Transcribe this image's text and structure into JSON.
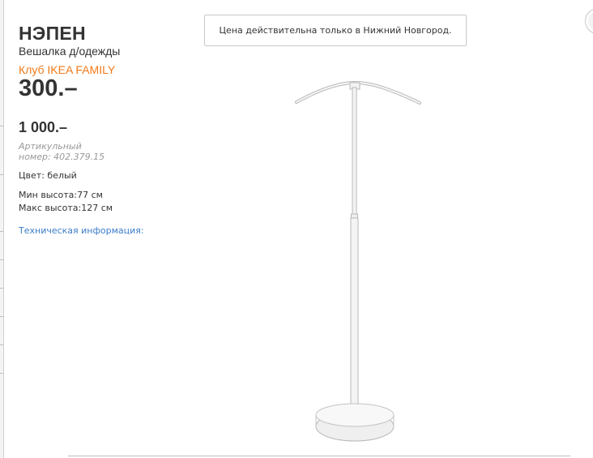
{
  "product": {
    "name": "НЭПЕН",
    "type": "Вешалка д/одежды",
    "family_label": "Клуб IKEA FAMILY",
    "family_price": "300.–",
    "regular_price": "1 000.–",
    "article_label": "Артикульный",
    "article_number": "номер: 402.379.15",
    "color": "Цвет: белый",
    "min_height": "Мин высота:77 см",
    "max_height": "Макс высота:127 см",
    "tech_info_link": "Техническая информация:"
  },
  "notice": {
    "text": "Цена действительна только в Нижний Новгород."
  },
  "image": {
    "icon": "clothes-stand-image"
  },
  "colors": {
    "family_accent": "#f27a1a",
    "link": "#3b7dc8",
    "muted": "#999999",
    "text": "#333333"
  }
}
